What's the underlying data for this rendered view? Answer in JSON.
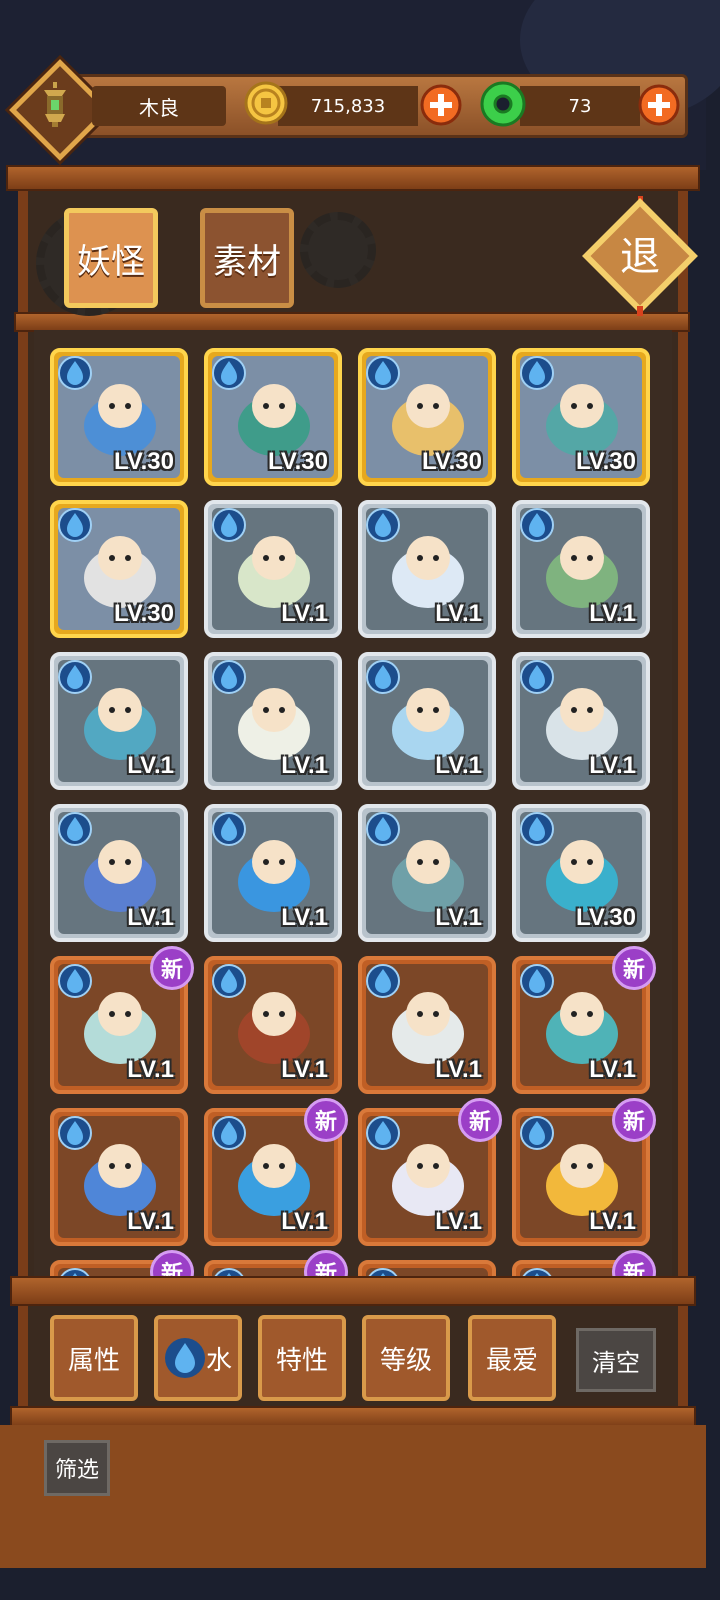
{
  "header": {
    "player_name": "木良",
    "coins": "715,833",
    "jade": "73"
  },
  "tabs": [
    {
      "label": "妖怪",
      "active": true
    },
    {
      "label": "素材",
      "active": false
    }
  ],
  "exit_label": "退",
  "cards": [
    {
      "tier": "gold",
      "level": "LV.30",
      "art": "blue-haired-dragon-spirit",
      "new": false
    },
    {
      "tier": "gold",
      "level": "LV.30",
      "art": "bearded-sage-with-flowers",
      "new": false
    },
    {
      "tier": "gold",
      "level": "LV.30",
      "art": "monkey-king-with-crown",
      "new": false
    },
    {
      "tier": "gold",
      "level": "LV.30",
      "art": "teal-haired-flute-player",
      "new": false
    },
    {
      "tier": "gold",
      "level": "LV.30",
      "art": "white-bearded-strategist",
      "new": false
    },
    {
      "tier": "silver",
      "level": "LV.1",
      "art": "zongzi-spirit",
      "new": false
    },
    {
      "tier": "silver",
      "level": "LV.1",
      "art": "cloud-spirit",
      "new": false
    },
    {
      "tier": "silver",
      "level": "LV.1",
      "art": "mahjong-tile-spirit",
      "new": false
    },
    {
      "tier": "silver",
      "level": "LV.1",
      "art": "boy-with-wind-chime",
      "new": false
    },
    {
      "tier": "silver",
      "level": "LV.1",
      "art": "radish-with-flag",
      "new": false
    },
    {
      "tier": "silver",
      "level": "LV.1",
      "art": "water-lily-spirit",
      "new": false
    },
    {
      "tier": "silver",
      "level": "LV.1",
      "art": "flying-sword",
      "new": false
    },
    {
      "tier": "silver",
      "level": "LV.1",
      "art": "blue-flower-spirit",
      "new": false
    },
    {
      "tier": "silver",
      "level": "LV.1",
      "art": "painter-girl",
      "new": false
    },
    {
      "tier": "silver",
      "level": "LV.1",
      "art": "fish-spirit",
      "new": false
    },
    {
      "tier": "silver",
      "level": "LV.30",
      "art": "ice-crown-girl",
      "new": false
    },
    {
      "tier": "bronze",
      "level": "LV.1",
      "art": "pill-ball-spirit",
      "new": true
    },
    {
      "tier": "bronze",
      "level": "LV.1",
      "art": "sausage-skewer",
      "new": false
    },
    {
      "tier": "bronze",
      "level": "LV.1",
      "art": "bucket-spirit",
      "new": false
    },
    {
      "tier": "bronze",
      "level": "LV.1",
      "art": "blue-dinosaur",
      "new": true
    },
    {
      "tier": "bronze",
      "level": "LV.1",
      "art": "blue-mushroom",
      "new": false
    },
    {
      "tier": "bronze",
      "level": "LV.1",
      "art": "blue-bird-in-nest",
      "new": true
    },
    {
      "tier": "bronze",
      "level": "LV.1",
      "art": "jellyfish-spirit",
      "new": true
    },
    {
      "tier": "bronze",
      "level": "LV.1",
      "art": "sea-slug",
      "new": true
    }
  ],
  "partial_row_new": [
    true,
    true,
    false,
    true
  ],
  "new_badge_text": "新",
  "filters": {
    "attribute": "属性",
    "element": "水",
    "trait": "特性",
    "level": "等级",
    "favorite": "最爱",
    "clear": "清空",
    "screen": "筛选"
  },
  "colors": {
    "gold_card": "#e6a81e",
    "silver_card": "#b8c3cc",
    "bronze_card": "#c05f25",
    "new_badge": "#9b3fc7",
    "wood": "#8a4a1e"
  }
}
